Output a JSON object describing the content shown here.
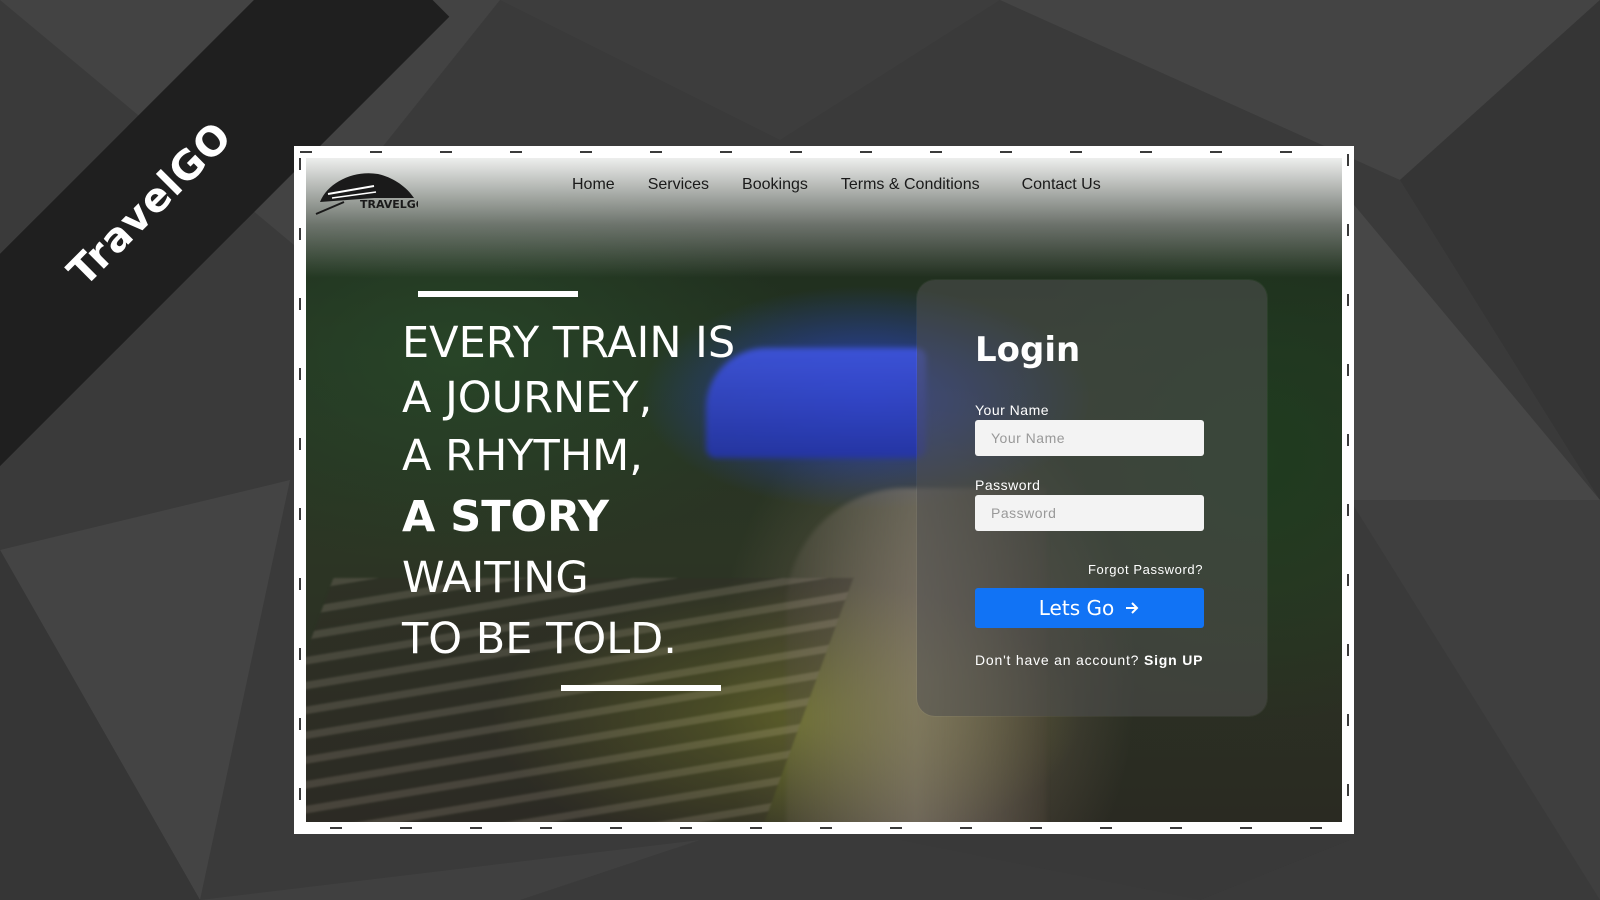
{
  "banner": {
    "brand": "TravelGO"
  },
  "nav": {
    "logo_text": "TRAVELGO",
    "links": [
      {
        "label": "Home"
      },
      {
        "label": "Services"
      },
      {
        "label": "Bookings"
      },
      {
        "label": "Terms & Conditions"
      },
      {
        "label": "Contact Us"
      }
    ]
  },
  "hero": {
    "lines": [
      "EVERY TRAIN IS",
      "A JOURNEY,",
      "A RHYTHM,",
      "A STORY",
      "WAITING",
      "TO BE TOLD."
    ]
  },
  "login": {
    "title": "Login",
    "name_label": "Your Name",
    "name_placeholder": "Your Name",
    "password_label": "Password",
    "password_placeholder": "Password",
    "forgot": "Forgot Password?",
    "submit": "Lets Go",
    "signup_prompt": "Don't have an account?",
    "signup_link": "Sign UP"
  },
  "colors": {
    "accent": "#1173f5",
    "banner": "#1f1f1f",
    "background": "#3a3a3a"
  }
}
